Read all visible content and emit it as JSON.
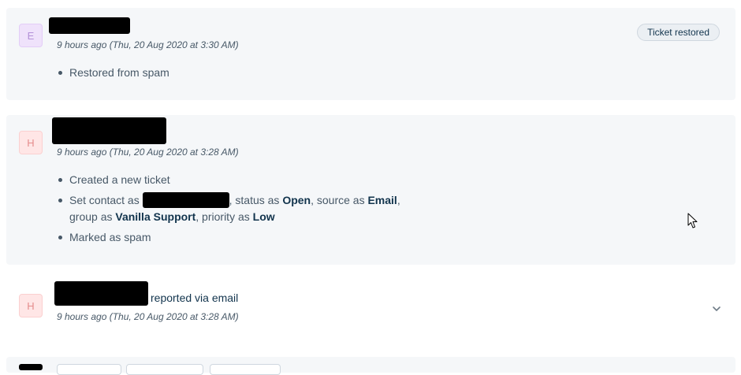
{
  "activities": [
    {
      "avatar_letter": "E",
      "time": "9 hours ago (Thu, 20 Aug 2020 at 3:30 AM)",
      "badge": "Ticket restored",
      "items": [
        "Restored from spam"
      ]
    },
    {
      "avatar_letter": "H",
      "time": "9 hours ago (Thu, 20 Aug 2020 at 3:28 AM)",
      "items": {
        "created": "Created a new ticket",
        "set_contact_prefix": "Set contact as",
        "status_prefix": ", status as",
        "status_value": "Open",
        "source_prefix": ", source as",
        "source_value": "Email",
        "group_prefix": "group as",
        "group_value": "Vanilla Support",
        "priority_prefix": ", priority as",
        "priority_value": "Low",
        "marked": "Marked as spam"
      }
    },
    {
      "avatar_letter": "H",
      "action": "reported via email",
      "time": "9 hours ago (Thu, 20 Aug 2020 at 3:28 AM)"
    }
  ],
  "icons": {
    "expand": "chevron-down-icon",
    "pointer": "mouse-cursor-icon"
  },
  "colors": {
    "card_bg": "#f5f7f9",
    "text_primary": "#12344d",
    "text_secondary": "#475867",
    "avatar_e_bg": "#efe2fb",
    "avatar_h_bg": "#ffe6e6"
  }
}
